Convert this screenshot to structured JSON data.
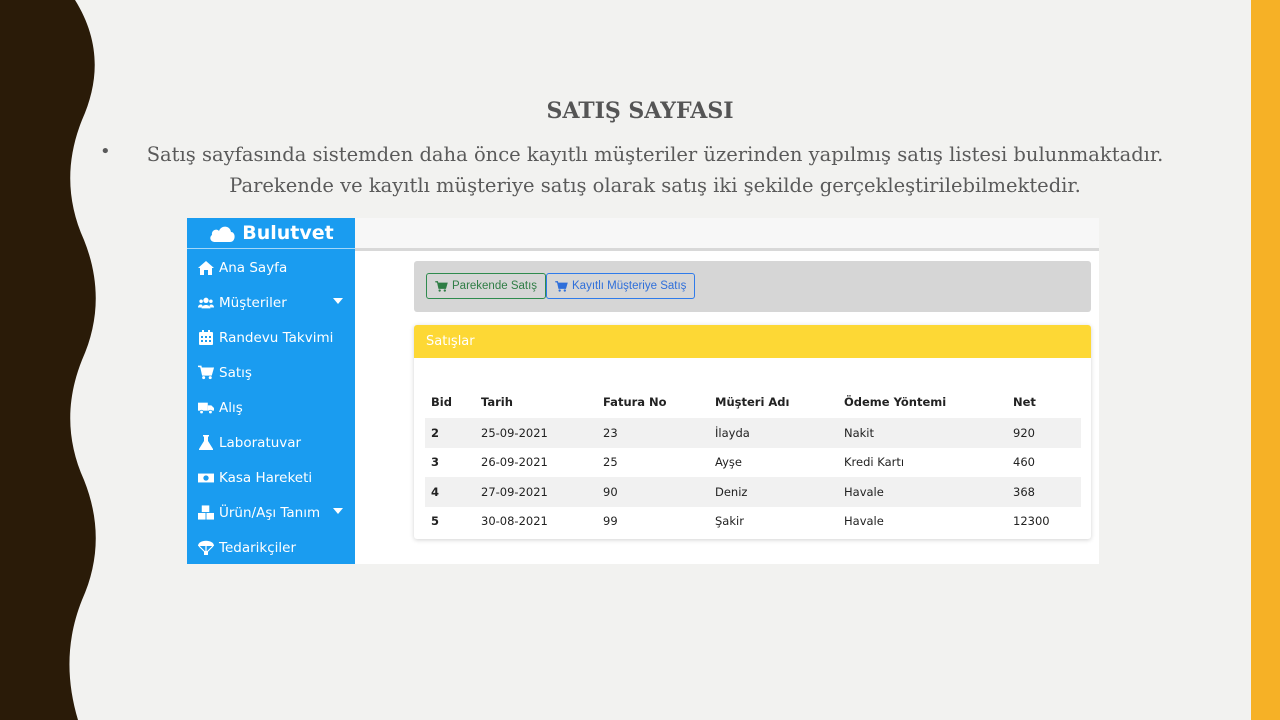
{
  "slide": {
    "title": "SATIŞ SAYFASI",
    "bullet_char": "•",
    "text": "Satış sayfasında sistemden daha önce kayıtlı müşteriler üzerinden yapılmış satış listesi bulunmaktadır. Parekende ve kayıtlı müşteriye satış olarak satış iki şekilde gerçekleştirilebilmektedir.",
    "colors": {
      "left_band": "#2a1b08",
      "right_band": "#f6b126",
      "background": "#f2f2f0"
    }
  },
  "app": {
    "brand": "Bulutvet",
    "brand_icon": "cloud-icon",
    "sidebar_color": "#1a9cf0",
    "nav": [
      {
        "label": "Ana Sayfa",
        "icon": "home-icon"
      },
      {
        "label": "Müşteriler",
        "icon": "users-icon",
        "has_submenu": true
      },
      {
        "label": "Randevu Takvimi",
        "icon": "calendar-icon"
      },
      {
        "label": "Satış",
        "icon": "cart-icon"
      },
      {
        "label": "Alış",
        "icon": "truck-icon"
      },
      {
        "label": "Laboratuvar",
        "icon": "flask-icon"
      },
      {
        "label": "Kasa Hareketi",
        "icon": "money-icon"
      },
      {
        "label": "Ürün/Aşı Tanım",
        "icon": "boxes-icon",
        "has_submenu": true
      },
      {
        "label": "Tedarikçiler",
        "icon": "parachute-icon"
      }
    ],
    "actions": {
      "retail_sale": "Parekende Satış",
      "registered_sale": "Kayıtlı Müşteriye Satış"
    },
    "sales": {
      "header": "Satışlar",
      "header_color": "#fdd835",
      "columns": [
        "Bid",
        "Tarih",
        "Fatura No",
        "Müşteri Adı",
        "Ödeme Yöntemi",
        "Net"
      ],
      "rows": [
        [
          "2",
          "25-09-2021",
          "23",
          "İlayda",
          "Nakit",
          "920"
        ],
        [
          "3",
          "26-09-2021",
          "25",
          "Ayşe",
          "Kredi Kartı",
          "460"
        ],
        [
          "4",
          "27-09-2021",
          "90",
          "Deniz",
          "Havale",
          "368"
        ],
        [
          "5",
          "30-08-2021",
          "99",
          "Şakir",
          "Havale",
          "12300"
        ]
      ]
    }
  }
}
